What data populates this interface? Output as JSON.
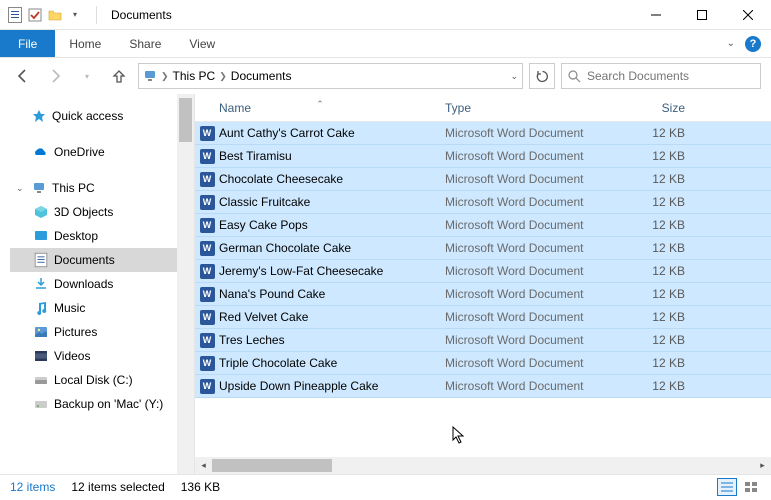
{
  "title": "Documents",
  "ribbon": {
    "file": "File",
    "home": "Home",
    "share": "Share",
    "view": "View"
  },
  "breadcrumb": [
    "This PC",
    "Documents"
  ],
  "search": {
    "placeholder": "Search Documents"
  },
  "nav": {
    "quick_access": "Quick access",
    "onedrive": "OneDrive",
    "this_pc": "This PC",
    "items": [
      "3D Objects",
      "Desktop",
      "Documents",
      "Downloads",
      "Music",
      "Pictures",
      "Videos",
      "Local Disk (C:)",
      "Backup on 'Mac' (Y:)"
    ]
  },
  "columns": {
    "name": "Name",
    "type": "Type",
    "size": "Size"
  },
  "filetype": "Microsoft Word Document",
  "filesize": "12 KB",
  "files": [
    "Aunt Cathy's Carrot Cake",
    "Best Tiramisu",
    "Chocolate Cheesecake",
    "Classic Fruitcake",
    "Easy Cake Pops",
    "German Chocolate Cake",
    "Jeremy's Low-Fat Cheesecake",
    "Nana's Pound Cake",
    "Red Velvet Cake",
    "Tres Leches",
    "Triple Chocolate Cake",
    "Upside Down Pineapple Cake"
  ],
  "status": {
    "count": "12 items",
    "selected": "12 items selected",
    "size": "136 KB"
  }
}
